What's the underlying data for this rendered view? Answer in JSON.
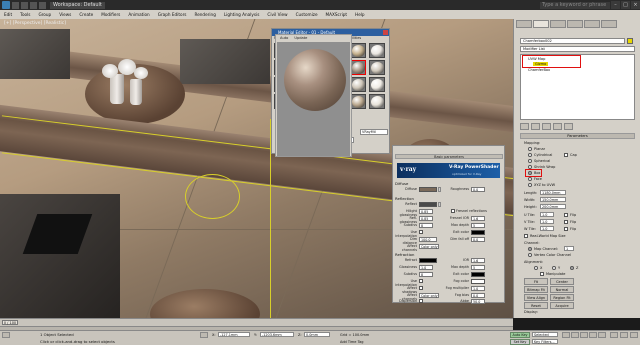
{
  "titlebar": {
    "workspace": "Workspace: Default",
    "search_placeholder": "Type a keyword or phrase"
  },
  "menubar": {
    "items": [
      "Edit",
      "Tools",
      "Group",
      "Views",
      "Create",
      "Modifiers",
      "Animation",
      "Graph Editors",
      "Rendering",
      "Lighting Analysis",
      "Civil View",
      "Customize",
      "MAXScript",
      "Help"
    ]
  },
  "viewport": {
    "label": "[+] [Perspective] [Realistic]"
  },
  "material_editor": {
    "title": "Material Editor - 01 - Default",
    "menu": [
      "Modes",
      "Material",
      "Navigation",
      "Options",
      "Utilities"
    ],
    "selected_slot": 10,
    "material_name": "21WF",
    "material_type": "VRayMtl",
    "preview_tabs": [
      "Auto",
      "Update"
    ]
  },
  "vray": {
    "rollout_basic": "Basic parameters",
    "banner_logo": "v·ray",
    "banner_name": "V-Ray PowerShader",
    "banner_sub": "optimized for V-Ray",
    "diffuse_section": "Diffuse",
    "diffuse_label": "Diffuse",
    "roughness_label": "Roughness",
    "roughness_value": "0.0",
    "reflection_section": "Reflection",
    "reflect_label": "Reflect",
    "hilight_gloss_label": "Hilight glossiness",
    "hilight_gloss_value": "0.85",
    "fresnel_label": "Fresnel reflections",
    "refl_gloss_label": "Refl. glossiness",
    "refl_gloss_value": "0.85",
    "fresnel_ior_label": "Fresnel IOR",
    "fresnel_ior_value": "1.6",
    "subdivs_label": "Subdivs",
    "subdivs_value": "8",
    "max_depth_label": "Max depth",
    "max_depth_value": "5",
    "use_interp_label": "Use interpolation",
    "exit_color_label": "Exit color",
    "dim_distance_label": "Dim distance",
    "dim_distance_value": "100.0",
    "dim_falloff_label": "Dim fall off",
    "dim_falloff_value": "0.0",
    "affect_channels_label": "Affect channels",
    "affect_channels_value": "Color only",
    "refraction_section": "Refraction",
    "refract_label": "Refract",
    "ior_label": "IOR",
    "ior_value": "1.6",
    "glossiness_label": "Glossiness",
    "glossiness_value": "1.0",
    "r_max_depth_value": "5",
    "r_subdivs_value": "8",
    "exit_color2_label": "Exit color",
    "use_interp2_label": "Use interpolation",
    "fog_color_label": "Fog color",
    "affect_shadows_label": "Affect shadows",
    "fog_mult_label": "Fog multiplier",
    "fog_mult_value": "1.0",
    "affect_channels2_label": "Affect channels",
    "affect_channels2_value": "Color only",
    "fog_bias_label": "Fog bias",
    "fog_bias_value": "0.0",
    "dispersion_label": "Dispersion",
    "abbe_label": "Abbe",
    "abbe_value": "50.0"
  },
  "command_panel": {
    "object_name": "Chamferbox002",
    "modifier_list": "Modifier List",
    "stack": [
      "UVW Map",
      "Gizmo",
      "ChamferBox"
    ],
    "parameters_rollout": "Parameters",
    "mapping_label": "Mapping:",
    "mapping_options": [
      "Planar",
      "Cylindrical",
      "Spherical",
      "Shrink Wrap",
      "Box",
      "Face",
      "XYZ to UVW"
    ],
    "cap_label": "Cap",
    "mapping_selected": "Box",
    "length_label": "Length:",
    "length_value": "1180.0mm",
    "width_label": "Width:",
    "width_value": "150.0mm",
    "height_label": "Height:",
    "height_value": "200.0mm",
    "u_tile_label": "U Tile:",
    "u_tile_value": "1.0",
    "v_tile_label": "V Tile:",
    "v_tile_value": "1.0",
    "w_tile_label": "W Tile:",
    "w_tile_value": "1.0",
    "flip_label": "Flip",
    "real_world_label": "Real-World Map Size",
    "channel_label": "Channel:",
    "map_channel_label": "Map Channel:",
    "map_channel_value": "1",
    "vertex_color_label": "Vertex Color Channel",
    "alignment_label": "Alignment:",
    "axes": [
      "X",
      "Y",
      "Z"
    ],
    "manipulate_label": "Manipulate",
    "fit_label": "Fit",
    "center_label": "Center",
    "bitmap_fit_label": "Bitmap Fit",
    "normal_align_label": "Normal Align",
    "view_align_label": "View Align",
    "region_fit_label": "Region Fit",
    "reset_label": "Reset",
    "acquire_label": "Acquire",
    "display_label": "Display:",
    "show_no_seams_label": "Show No Seams",
    "thin_seam_label": "Thin Seam Display"
  },
  "timeline": {
    "frame_label": "0 / 100",
    "ticks": [
      "0",
      "10",
      "20",
      "30",
      "40",
      "50",
      "60",
      "70",
      "80",
      "90",
      "100"
    ]
  },
  "status": {
    "selection": "1 Object Selected",
    "prompt": "Click or click-and-drag to select objects",
    "x_label": "X:",
    "x_value": "-127.1mm",
    "y_label": "Y:",
    "y_value": "-1203.6mm",
    "z_label": "Z:",
    "z_value": "0.0mm",
    "grid_label": "Grid = 100.0mm",
    "autokey_label": "Auto Key",
    "selected_label": "Selected",
    "setkey_label": "Set Key",
    "keyfilters_label": "Key Filters...",
    "add_time_tag": "Add Time Tag"
  }
}
